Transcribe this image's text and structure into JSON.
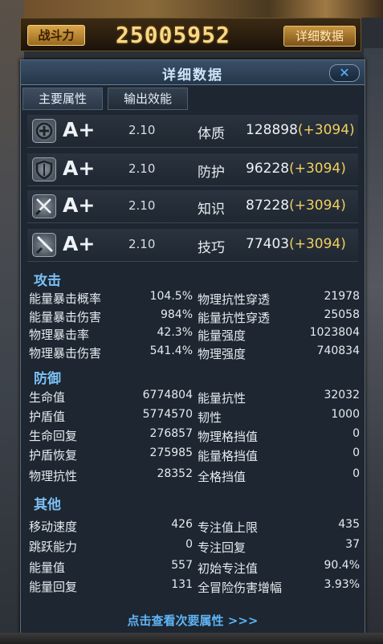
{
  "header": {
    "power_label": "战斗力",
    "power_value": "25005952",
    "detail_button": "详细数据"
  },
  "panel": {
    "title": "详细数据",
    "close_label": "✕",
    "tabs": [
      {
        "label": "主要属性"
      },
      {
        "label": "输出效能"
      }
    ],
    "attributes": [
      {
        "icon": "plus-circle-icon",
        "grade": "A+",
        "multiplier": "2.10",
        "name": "体质",
        "value": "128898",
        "bonus": "(+3094)"
      },
      {
        "icon": "shield-icon",
        "grade": "A+",
        "multiplier": "2.10",
        "name": "防护",
        "value": "96228",
        "bonus": "(+3094)"
      },
      {
        "icon": "crossed-swords-icon",
        "grade": "A+",
        "multiplier": "2.10",
        "name": "知识",
        "value": "87228",
        "bonus": "(+3094)"
      },
      {
        "icon": "sword-icon",
        "grade": "A+",
        "multiplier": "2.10",
        "name": "技巧",
        "value": "77403",
        "bonus": "(+3094)"
      }
    ],
    "sections": {
      "attack": {
        "title": "攻击",
        "rows": [
          {
            "l_name": "能量暴击概率",
            "l_val": "104.5%",
            "r_name": "物理抗性穿透",
            "r_val": "21978"
          },
          {
            "l_name": "能量暴击伤害",
            "l_val": "984%",
            "r_name": "能量抗性穿透",
            "r_val": "25058"
          },
          {
            "l_name": "物理暴击率",
            "l_val": "42.3%",
            "r_name": "能量强度",
            "r_val": "1023804"
          },
          {
            "l_name": "物理暴击伤害",
            "l_val": "541.4%",
            "r_name": "物理强度",
            "r_val": "740834"
          }
        ]
      },
      "defense": {
        "title": "防御",
        "rows": [
          {
            "l_name": "生命值",
            "l_val": "6774804",
            "r_name": "能量抗性",
            "r_val": "32032"
          },
          {
            "l_name": "护盾值",
            "l_val": "5774570",
            "r_name": "韧性",
            "r_val": "1000"
          },
          {
            "l_name": "生命回复",
            "l_val": "276857",
            "r_name": "物理格挡值",
            "r_val": "0"
          },
          {
            "l_name": "护盾恢复",
            "l_val": "275985",
            "r_name": "能量格挡值",
            "r_val": "0"
          },
          {
            "l_name": "物理抗性",
            "l_val": "28352",
            "r_name": "全格挡值",
            "r_val": "0"
          }
        ]
      },
      "other": {
        "title": "其他",
        "rows": [
          {
            "l_name": "移动速度",
            "l_val": "426",
            "r_name": "专注值上限",
            "r_val": "435"
          },
          {
            "l_name": "跳跃能力",
            "l_val": "0",
            "r_name": "专注回复",
            "r_val": "37"
          },
          {
            "l_name": "能量值",
            "l_val": "557",
            "r_name": "初始专注值",
            "r_val": "90.4%"
          },
          {
            "l_name": "能量回复",
            "l_val": "131",
            "r_name": "全冒险伤害增幅",
            "r_val": "3.93%"
          }
        ]
      }
    },
    "footer": "点击查看次要属性 >>>"
  },
  "colors": {
    "accent_blue": "#5fb4f5",
    "section_blue": "#7cc0f4",
    "bonus_gold": "#f2cf5d",
    "power_gold": "#f7d887"
  }
}
